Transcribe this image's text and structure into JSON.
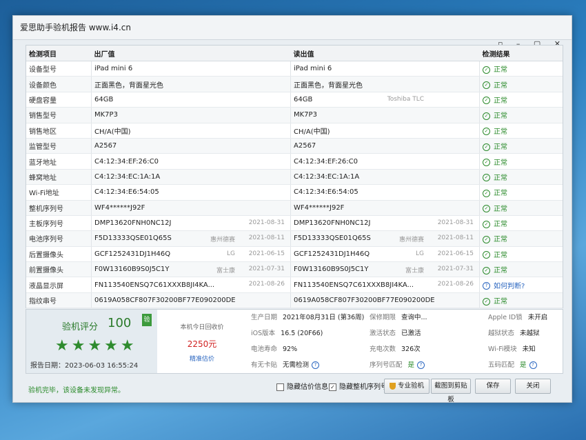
{
  "window": {
    "title": "爱思助手验机报告 www.i4.cn",
    "controls": "▫ – ▢ ✕"
  },
  "table": {
    "headers": {
      "item": "检测项目",
      "factory": "出厂值",
      "read": "读出值",
      "result": "检测结果"
    },
    "rows": [
      {
        "item": "设备型号",
        "factory": "iPad mini 6",
        "factory_note": "",
        "factory_date": "",
        "read": "iPad mini 6",
        "read_note": "",
        "read_date": "",
        "result": "正常"
      },
      {
        "item": "设备颜色",
        "factory": "正面黑色，背面星光色",
        "factory_note": "",
        "factory_date": "",
        "read": "正面黑色，背面星光色",
        "read_note": "",
        "read_date": "",
        "result": "正常"
      },
      {
        "item": "硬盘容量",
        "factory": "64GB",
        "factory_note": "",
        "factory_date": "",
        "read": "64GB",
        "read_note": "Toshiba TLC",
        "read_date": "",
        "result": "正常"
      },
      {
        "item": "销售型号",
        "factory": "MK7P3",
        "factory_note": "",
        "factory_date": "",
        "read": "MK7P3",
        "read_note": "",
        "read_date": "",
        "result": "正常"
      },
      {
        "item": "销售地区",
        "factory": "CH/A(中国)",
        "factory_note": "",
        "factory_date": "",
        "read": "CH/A(中国)",
        "read_note": "",
        "read_date": "",
        "result": "正常"
      },
      {
        "item": "监管型号",
        "factory": "A2567",
        "factory_note": "",
        "factory_date": "",
        "read": "A2567",
        "read_note": "",
        "read_date": "",
        "result": "正常"
      },
      {
        "item": "蓝牙地址",
        "factory": "C4:12:34:EF:26:C0",
        "factory_note": "",
        "factory_date": "",
        "read": "C4:12:34:EF:26:C0",
        "read_note": "",
        "read_date": "",
        "result": "正常"
      },
      {
        "item": "蜂窝地址",
        "factory": "C4:12:34:EC:1A:1A",
        "factory_note": "",
        "factory_date": "",
        "read": "C4:12:34:EC:1A:1A",
        "read_note": "",
        "read_date": "",
        "result": "正常"
      },
      {
        "item": "Wi-Fi地址",
        "factory": "C4:12:34:E6:54:05",
        "factory_note": "",
        "factory_date": "",
        "read": "C4:12:34:E6:54:05",
        "read_note": "",
        "read_date": "",
        "result": "正常"
      },
      {
        "item": "整机序列号",
        "factory": "WF4******J92F",
        "factory_note": "",
        "factory_date": "",
        "read": "WF4******J92F",
        "read_note": "",
        "read_date": "",
        "result": "正常"
      },
      {
        "item": "主板序列号",
        "factory": "DMP13620FNH0NC12J",
        "factory_note": "",
        "factory_date": "2021-08-31",
        "read": "DMP13620FNH0NC12J",
        "read_note": "",
        "read_date": "2021-08-31",
        "result": "正常"
      },
      {
        "item": "电池序列号",
        "factory": "F5D13333QSE01Q65S",
        "factory_note": "惠州德赛",
        "factory_date": "2021-08-11",
        "read": "F5D13333QSE01Q65S",
        "read_note": "惠州德赛",
        "read_date": "2021-08-11",
        "result": "正常"
      },
      {
        "item": "后置摄像头",
        "factory": "GCF1252431DJ1H46Q",
        "factory_note": "LG",
        "factory_date": "2021-06-15",
        "read": "GCF1252431DJ1H46Q",
        "read_note": "LG",
        "read_date": "2021-06-15",
        "result": "正常"
      },
      {
        "item": "前置摄像头",
        "factory": "F0W13160B9S0J5C1Y",
        "factory_note": "富士康",
        "factory_date": "2021-07-31",
        "read": "F0W13160B9S0J5C1Y",
        "read_note": "富士康",
        "read_date": "2021-07-31",
        "result": "正常"
      },
      {
        "item": "液晶显示屏",
        "factory": "FN113540ENSQ7C61XXXB8JI4KA...",
        "factory_note": "",
        "factory_date": "2021-08-26",
        "read": "FN113540ENSQ7C61XXXB8JI4KA...",
        "read_note": "",
        "read_date": "2021-08-26",
        "result": "如何判断?"
      },
      {
        "item": "指纹串号",
        "factory": "0619A058CF807F30200BF77E090200DE",
        "factory_note": "",
        "factory_date": "",
        "read": "0619A058CF807F30200BF77E090200DE",
        "read_note": "",
        "read_date": "",
        "result": "正常"
      }
    ]
  },
  "score": {
    "label": "验机评分",
    "value": "100",
    "badge": "验",
    "stars": "★★★★★",
    "report_date": "报告日期：2023-06-03 16:55:24"
  },
  "valuation": {
    "label": "本机今日回收价",
    "price": "2250元",
    "link": "精准估价"
  },
  "info": {
    "mfg_date_k": "生产日期",
    "mfg_date_v": "2021年08月31日 (第36周)",
    "ios_k": "iOS版本",
    "ios_v": "16.5 (20F66)",
    "battery_k": "电池寿命",
    "battery_v": "92%",
    "sim_k": "有无卡贴",
    "sim_v": "无需检测",
    "warranty_k": "保修期限",
    "warranty_v": "查询中...",
    "activation_k": "激活状态",
    "activation_v": "已激活",
    "charge_k": "充电次数",
    "charge_v": "326次",
    "serial_match_k": "序列号匹配",
    "serial_match_v": "是",
    "appleid_k": "Apple ID锁",
    "appleid_v": "未开启",
    "jailbreak_k": "越狱状态",
    "jailbreak_v": "未越狱",
    "wifi_k": "Wi-Fi模块",
    "wifi_v": "未知",
    "five_code_k": "五码匹配",
    "five_code_v": "是"
  },
  "footer": {
    "status": "验机完毕，该设备未发现异常。",
    "hide_price": "隐藏估价信息",
    "hide_serial": "隐藏整机序列号",
    "pro_check": "专业验机",
    "screenshot": "截图到剪贴板",
    "save": "保存",
    "close": "关闭"
  },
  "colors": {
    "ok": "#2a8a2a",
    "price": "#d02020",
    "link": "#2a66c0"
  }
}
